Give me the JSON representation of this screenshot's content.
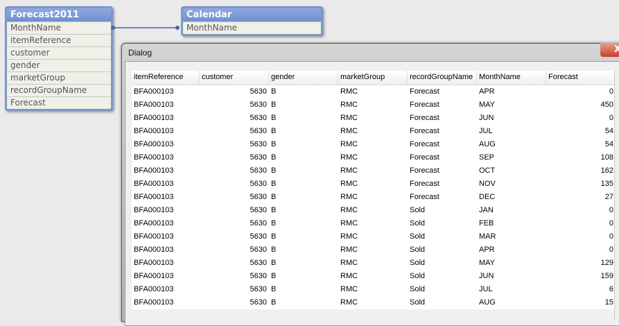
{
  "tables": [
    {
      "title": "Forecast2011",
      "fields": [
        "MonthName",
        "itemReference",
        "customer",
        "gender",
        "marketGroup",
        "recordGroupName",
        "Forecast"
      ]
    },
    {
      "title": "Calendar",
      "fields": [
        "MonthName"
      ]
    }
  ],
  "dialog": {
    "title": "Dialog",
    "close_label": "X",
    "columns": [
      "itemReference",
      "customer",
      "gender",
      "marketGroup",
      "recordGroupName",
      "MonthName",
      "Forecast"
    ],
    "rows": [
      [
        "BFA000103",
        "5630",
        "B",
        "RMC",
        "Forecast",
        "APR",
        "0"
      ],
      [
        "BFA000103",
        "5630",
        "B",
        "RMC",
        "Forecast",
        "MAY",
        "450"
      ],
      [
        "BFA000103",
        "5630",
        "B",
        "RMC",
        "Forecast",
        "JUN",
        "0"
      ],
      [
        "BFA000103",
        "5630",
        "B",
        "RMC",
        "Forecast",
        "JUL",
        "54"
      ],
      [
        "BFA000103",
        "5630",
        "B",
        "RMC",
        "Forecast",
        "AUG",
        "54"
      ],
      [
        "BFA000103",
        "5630",
        "B",
        "RMC",
        "Forecast",
        "SEP",
        "108"
      ],
      [
        "BFA000103",
        "5630",
        "B",
        "RMC",
        "Forecast",
        "OCT",
        "162"
      ],
      [
        "BFA000103",
        "5630",
        "B",
        "RMC",
        "Forecast",
        "NOV",
        "135"
      ],
      [
        "BFA000103",
        "5630",
        "B",
        "RMC",
        "Forecast",
        "DEC",
        "27"
      ],
      [
        "BFA000103",
        "5630",
        "B",
        "RMC",
        "Sold",
        "JAN",
        "0"
      ],
      [
        "BFA000103",
        "5630",
        "B",
        "RMC",
        "Sold",
        "FEB",
        "0"
      ],
      [
        "BFA000103",
        "5630",
        "B",
        "RMC",
        "Sold",
        "MAR",
        "0"
      ],
      [
        "BFA000103",
        "5630",
        "B",
        "RMC",
        "Sold",
        "APR",
        "0"
      ],
      [
        "BFA000103",
        "5630",
        "B",
        "RMC",
        "Sold",
        "MAY",
        "129"
      ],
      [
        "BFA000103",
        "5630",
        "B",
        "RMC",
        "Sold",
        "JUN",
        "159"
      ],
      [
        "BFA000103",
        "5630",
        "B",
        "RMC",
        "Sold",
        "JUL",
        "6"
      ],
      [
        "BFA000103",
        "5630",
        "B",
        "RMC",
        "Sold",
        "AUG",
        "15"
      ]
    ]
  }
}
